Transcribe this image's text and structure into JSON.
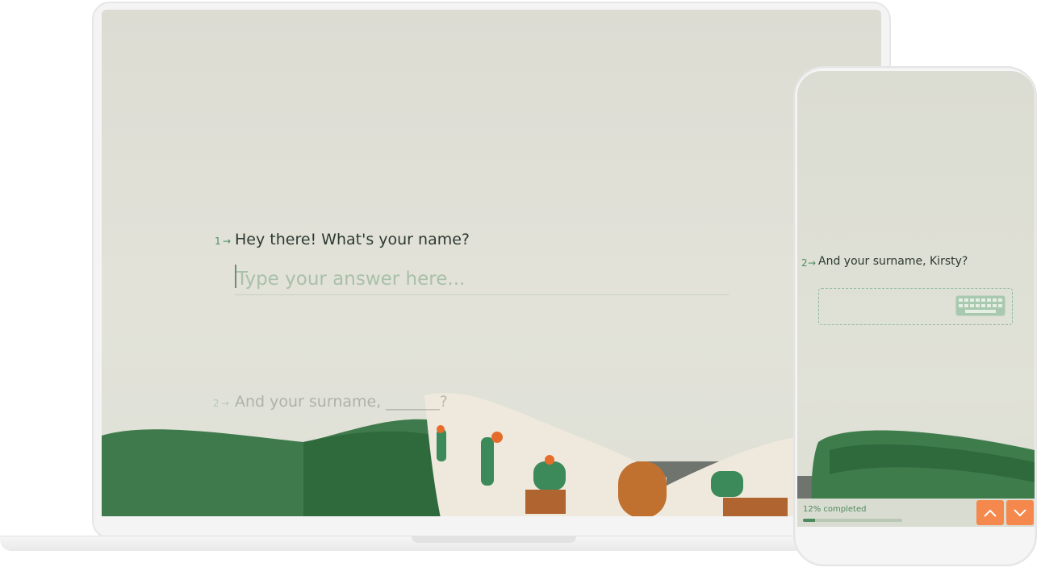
{
  "laptop": {
    "questions": [
      {
        "number": "1",
        "text": "Hey there! What's your name?",
        "placeholder": "Type your answer here..."
      },
      {
        "number": "2",
        "text": "And your surname, _______?"
      }
    ]
  },
  "phone": {
    "question": {
      "number": "2",
      "text": "And your surname, Kirsty?"
    },
    "progress": {
      "label": "12% completed",
      "percent": 12
    }
  },
  "icons": {
    "arrow": "right-arrow-icon",
    "keyboard": "keyboard-icon",
    "up": "chevron-up-icon",
    "down": "chevron-down-icon"
  },
  "colors": {
    "accent": "#4d8a5e",
    "nav_button": "#f5894d",
    "background": "#dedfd5"
  }
}
